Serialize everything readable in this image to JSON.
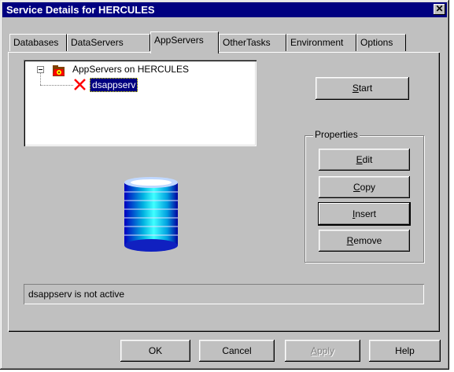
{
  "window": {
    "title": "Service Details for HERCULES",
    "close_glyph": "✕"
  },
  "tabs": [
    "Databases",
    "DataServers",
    "AppServers",
    "OtherTasks",
    "Environment",
    "Options"
  ],
  "active_tab": "AppServers",
  "tree": {
    "root_label": "AppServers on HERCULES",
    "root_icon": "appservers-folder-icon",
    "child_label": "dsappserv",
    "child_icon": "inactive-x-icon"
  },
  "buttons": {
    "start": {
      "pre": "",
      "u": "S",
      "post": "tart"
    },
    "properties_label": "Properties",
    "edit": {
      "pre": "",
      "u": "E",
      "post": "dit"
    },
    "copy": {
      "pre": "",
      "u": "C",
      "post": "opy"
    },
    "insert": {
      "pre": "",
      "u": "I",
      "post": "nsert"
    },
    "remove": {
      "pre": "",
      "u": "R",
      "post": "emove"
    }
  },
  "status_text": "dsappserv is not active",
  "footer": {
    "ok": "OK",
    "cancel": "Cancel",
    "apply": {
      "pre": "",
      "u": "A",
      "post": "pply"
    },
    "help": "Help"
  },
  "colors": {
    "titlebar": "#000080",
    "selection": "#000080",
    "face": "#c0c0c0",
    "x_mark": "#ff0000"
  }
}
